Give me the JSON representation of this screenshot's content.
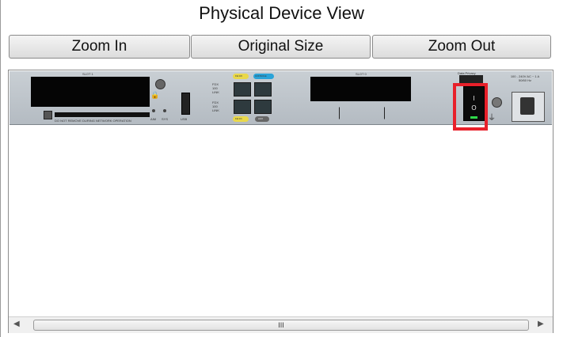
{
  "window": {
    "title": "Physical Device View"
  },
  "toolbar": {
    "zoom_in": "Zoom In",
    "original_size": "Original Size",
    "zoom_out": "Zoom Out"
  },
  "device": {
    "slot1": "SLOT 1",
    "slot0": "SLOT 0",
    "warning": "DO NOT REMOVE DURING NETWORK OPERATION",
    "power_label": "100 - 240V AC ~ 1 A 50/60 Hz",
    "data_privacy": "Data Privacy",
    "port_labels": [
      "FE 0/0",
      "CONSOLE",
      "FE 0/1",
      "AUX"
    ],
    "small_labels": [
      "FDX",
      "100",
      "LINK"
    ],
    "switch_on": "I",
    "switch_off": "O",
    "led_labels": [
      "AIM",
      "SYS"
    ],
    "usb_label": "USB"
  },
  "scrollbar": {
    "grip": "III",
    "left_arrow": "◀",
    "right_arrow": "▶"
  }
}
